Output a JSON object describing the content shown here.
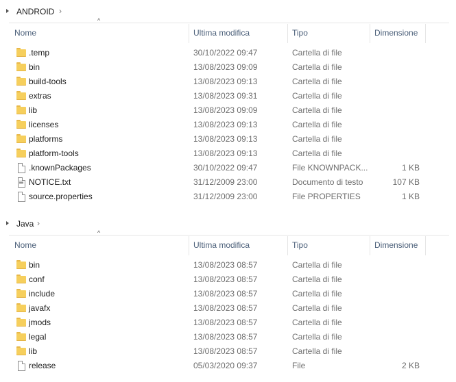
{
  "columns": {
    "name": "Nome",
    "modified": "Ultima modifica",
    "type": "Tipo",
    "size": "Dimensione"
  },
  "groups": [
    {
      "name": "ANDROID",
      "items": [
        {
          "name": ".temp",
          "modified": "30/10/2022 09:47",
          "type": "Cartella di file",
          "size": "",
          "icon": "folder-icon"
        },
        {
          "name": "bin",
          "modified": "13/08/2023 09:09",
          "type": "Cartella di file",
          "size": "",
          "icon": "folder-icon"
        },
        {
          "name": "build-tools",
          "modified": "13/08/2023 09:13",
          "type": "Cartella di file",
          "size": "",
          "icon": "folder-icon"
        },
        {
          "name": "extras",
          "modified": "13/08/2023 09:31",
          "type": "Cartella di file",
          "size": "",
          "icon": "folder-icon"
        },
        {
          "name": "lib",
          "modified": "13/08/2023 09:09",
          "type": "Cartella di file",
          "size": "",
          "icon": "folder-icon"
        },
        {
          "name": "licenses",
          "modified": "13/08/2023 09:13",
          "type": "Cartella di file",
          "size": "",
          "icon": "folder-icon"
        },
        {
          "name": "platforms",
          "modified": "13/08/2023 09:13",
          "type": "Cartella di file",
          "size": "",
          "icon": "folder-icon"
        },
        {
          "name": "platform-tools",
          "modified": "13/08/2023 09:13",
          "type": "Cartella di file",
          "size": "",
          "icon": "folder-icon"
        },
        {
          "name": ".knownPackages",
          "modified": "30/10/2022 09:47",
          "type": "File KNOWNPACK...",
          "size": "1 KB",
          "icon": "file-icon"
        },
        {
          "name": "NOTICE.txt",
          "modified": "31/12/2009 23:00",
          "type": "Documento di testo",
          "size": "107 KB",
          "icon": "text-file-icon"
        },
        {
          "name": "source.properties",
          "modified": "31/12/2009 23:00",
          "type": "File PROPERTIES",
          "size": "1 KB",
          "icon": "file-icon"
        }
      ]
    },
    {
      "name": "Java",
      "items": [
        {
          "name": "bin",
          "modified": "13/08/2023 08:57",
          "type": "Cartella di file",
          "size": "",
          "icon": "folder-icon"
        },
        {
          "name": "conf",
          "modified": "13/08/2023 08:57",
          "type": "Cartella di file",
          "size": "",
          "icon": "folder-icon"
        },
        {
          "name": "include",
          "modified": "13/08/2023 08:57",
          "type": "Cartella di file",
          "size": "",
          "icon": "folder-icon"
        },
        {
          "name": "javafx",
          "modified": "13/08/2023 08:57",
          "type": "Cartella di file",
          "size": "",
          "icon": "folder-icon"
        },
        {
          "name": "jmods",
          "modified": "13/08/2023 08:57",
          "type": "Cartella di file",
          "size": "",
          "icon": "folder-icon"
        },
        {
          "name": "legal",
          "modified": "13/08/2023 08:57",
          "type": "Cartella di file",
          "size": "",
          "icon": "folder-icon"
        },
        {
          "name": "lib",
          "modified": "13/08/2023 08:57",
          "type": "Cartella di file",
          "size": "",
          "icon": "folder-icon"
        },
        {
          "name": "release",
          "modified": "05/03/2020 09:37",
          "type": "File",
          "size": "2 KB",
          "icon": "file-icon"
        }
      ]
    }
  ]
}
